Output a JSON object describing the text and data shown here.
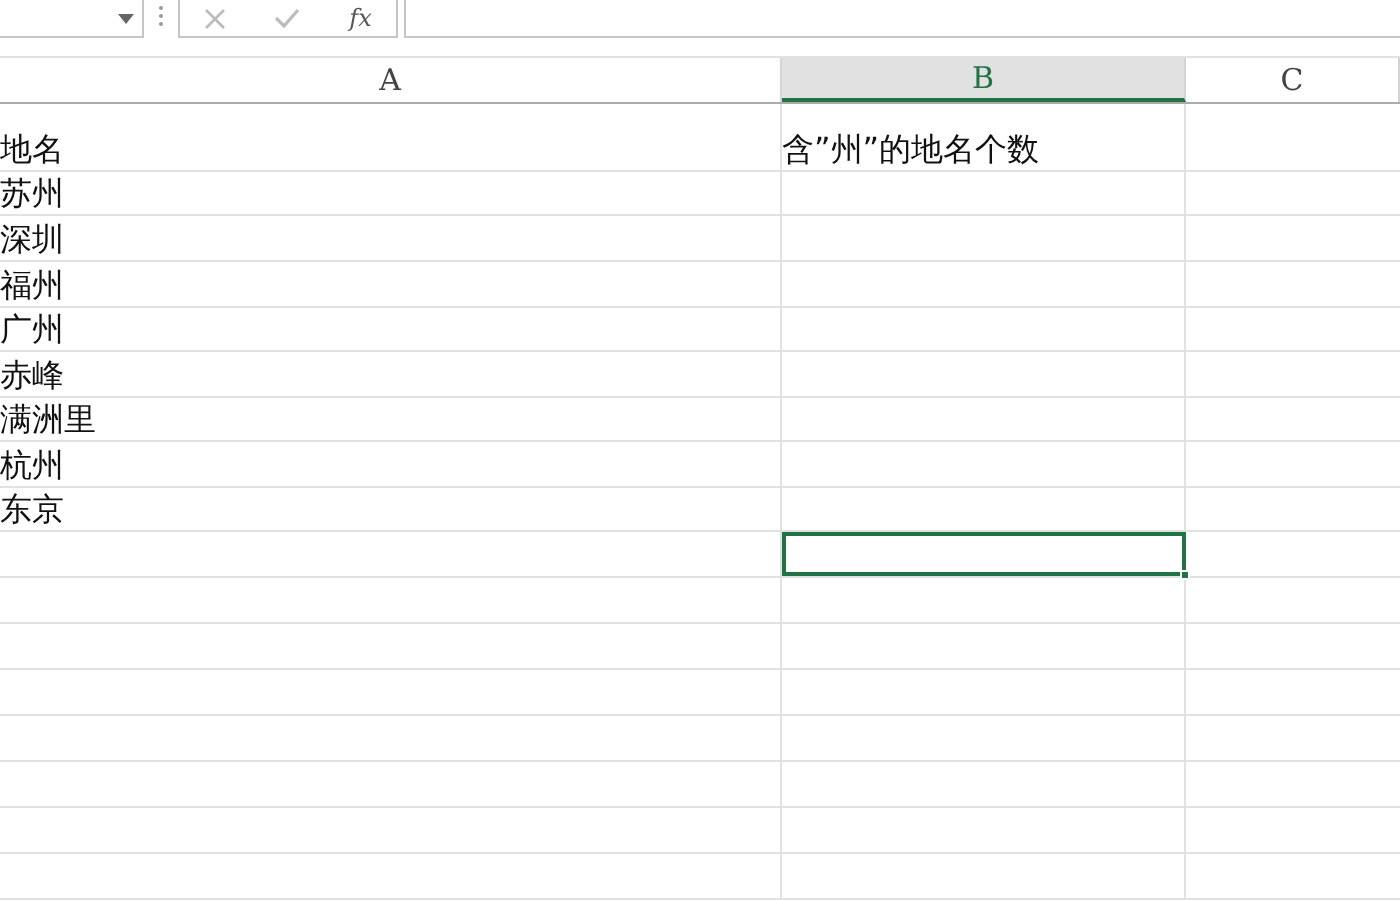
{
  "formula_bar": {
    "fx_label": "fx"
  },
  "columns": [
    {
      "label": "A",
      "selected": false
    },
    {
      "label": "B",
      "selected": true
    },
    {
      "label": "C",
      "selected": false
    }
  ],
  "rows": [
    {
      "a": "地名",
      "b": "含”州”的地名个数",
      "b_selected": false
    },
    {
      "a": "苏州",
      "b_selected": false
    },
    {
      "a": "深圳",
      "b_selected": false
    },
    {
      "a": "福州",
      "b_selected": false
    },
    {
      "a": "广州",
      "b_selected": false
    },
    {
      "a": "赤峰",
      "b_selected": false
    },
    {
      "a": "满洲里",
      "b_selected": false
    },
    {
      "a": "杭州",
      "b_selected": false
    },
    {
      "a": "东京",
      "b_selected": false
    },
    {
      "b_selected": true
    }
  ]
}
